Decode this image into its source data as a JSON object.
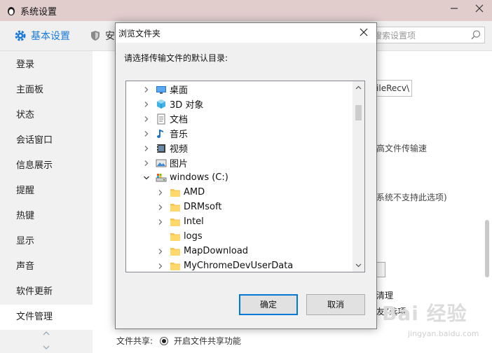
{
  "window": {
    "title": "系统设置"
  },
  "header": {
    "tab_basic": "基本设置",
    "tab_security": "安",
    "search_placeholder": "搜索设置项"
  },
  "sidebar": {
    "items": [
      {
        "label": "登录"
      },
      {
        "label": "主面板"
      },
      {
        "label": "状态"
      },
      {
        "label": "会话窗口"
      },
      {
        "label": "信息展示"
      },
      {
        "label": "提醒"
      },
      {
        "label": "热键"
      },
      {
        "label": "显示"
      },
      {
        "label": "声音"
      },
      {
        "label": "软件更新"
      },
      {
        "label": "文件管理"
      }
    ],
    "active_index": 10
  },
  "content": {
    "path_value": "FileRecv\\",
    "frag_transfer_speed": "高文件传输速",
    "frag_system_unsupported": "系统不支持此选项)",
    "frag_clean": "清理",
    "frag_option": "友”选项",
    "share_label": "文件共享:",
    "share_option": "开启文件共享功能"
  },
  "watermark": {
    "text": "Bai 经验",
    "sub": "jingyan.baidu.com"
  },
  "dialog": {
    "title": "浏览文件夹",
    "prompt": "请选择传输文件的默认目录:",
    "ok_label": "确定",
    "cancel_label": "取消",
    "tree": [
      {
        "label": "桌面",
        "icon": "desktop-icon",
        "level": 0,
        "expander": "collapsed"
      },
      {
        "label": "3D 对象",
        "icon": "3d-objects-icon",
        "level": 0,
        "expander": "collapsed"
      },
      {
        "label": "文档",
        "icon": "document-icon",
        "level": 0,
        "expander": "collapsed"
      },
      {
        "label": "音乐",
        "icon": "music-icon",
        "level": 0,
        "expander": "collapsed"
      },
      {
        "label": "视频",
        "icon": "video-icon",
        "level": 0,
        "expander": "collapsed"
      },
      {
        "label": "图片",
        "icon": "picture-icon",
        "level": 0,
        "expander": "collapsed"
      },
      {
        "label": "windows (C:)",
        "icon": "drive-icon",
        "level": 0,
        "expander": "expanded"
      },
      {
        "label": "AMD",
        "icon": "folder-icon",
        "level": 1,
        "expander": "collapsed"
      },
      {
        "label": "DRMsoft",
        "icon": "folder-icon",
        "level": 1,
        "expander": "collapsed"
      },
      {
        "label": "Intel",
        "icon": "folder-icon",
        "level": 1,
        "expander": "collapsed"
      },
      {
        "label": "logs",
        "icon": "folder-icon",
        "level": 1,
        "expander": "none"
      },
      {
        "label": "MapDownload",
        "icon": "folder-icon",
        "level": 1,
        "expander": "collapsed"
      },
      {
        "label": "MyChromeDevUserData",
        "icon": "folder-icon",
        "level": 1,
        "expander": "collapsed"
      }
    ]
  },
  "colors": {
    "accent": "#1a7ad8",
    "titlebar": "#e2cdcd",
    "primary_border": "#0078d7"
  }
}
